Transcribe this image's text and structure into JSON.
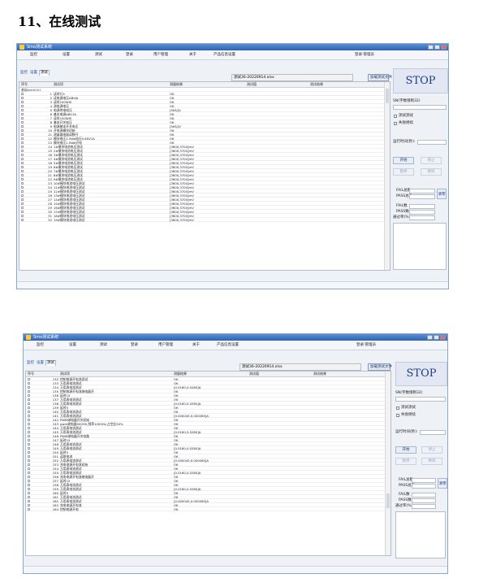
{
  "heading": "11、在线测试",
  "windows": [
    {
      "title": "Smo测试系统",
      "menu": [
        "监控",
        "设置",
        "测试",
        "登录",
        "用户管理",
        "关于",
        "产品信息设置"
      ],
      "menu_right": "登录:管理员",
      "tabs": [
        "监控",
        "设置",
        "测试"
      ],
      "file_name": "测试36-20220914.xlsx",
      "file_button": "加载测试文件",
      "columns": [
        "序号",
        "测试项",
        "测量结果",
        "测试值",
        "测试结果"
      ],
      "group_label": "基础test0001",
      "rows": [
        {
          "n": "1",
          "name": "读时行5",
          "result": "OK"
        },
        {
          "n": "2",
          "name": "读电源电压ABVIA",
          "result": "OK"
        },
        {
          "n": "3",
          "name": "读时100WIS",
          "result": "OK"
        },
        {
          "n": "4",
          "name": "测电源电压",
          "result": "OK"
        },
        {
          "n": "5",
          "name": "电源供电电压",
          "result": "[5kS/]V"
        },
        {
          "n": "6",
          "name": "基本电源ABV1A",
          "result": "OK"
        },
        {
          "n": "7",
          "name": "读时100WIS",
          "result": "OK"
        },
        {
          "n": "8",
          "name": "基本开关电压",
          "result": "OK"
        },
        {
          "n": "9",
          "name": "电源基本开关电压",
          "result": "[5kS/]V"
        },
        {
          "n": "10",
          "name": "开电源模块初始",
          "result": "OK"
        },
        {
          "n": "11",
          "name": "测量器电量读数开",
          "result": "OK"
        },
        {
          "n": "12",
          "name": "模块电压1.5Wa电压5.6SV1A",
          "result": "OK"
        },
        {
          "n": "13",
          "name": "模块电压1.5WA开电",
          "result": "OK"
        },
        {
          "n": "14",
          "name": "1#模块电池电压测试",
          "result": "[3600,3700]mV"
        },
        {
          "n": "15",
          "name": "2#模块电池电压测试",
          "result": "[3600,3700]mV"
        },
        {
          "n": "16",
          "name": "3#模块电池电压测试",
          "result": "[3600,3700]mV"
        },
        {
          "n": "17",
          "name": "4#模块电池电压测试",
          "result": "[3600,3700]mV"
        },
        {
          "n": "18",
          "name": "5#模块电池电压测试",
          "result": "[3600,3700]mV"
        },
        {
          "n": "19",
          "name": "6#模块电池电压测试",
          "result": "[3600,3700]mV"
        },
        {
          "n": "20",
          "name": "7#模块电池电压测试",
          "result": "[3600,3700]mV"
        },
        {
          "n": "21",
          "name": "8#模块电池电压测试",
          "result": "[3600,3700]mV"
        },
        {
          "n": "22",
          "name": "9#模块电池电压测试",
          "result": "[3600,3700]mV"
        },
        {
          "n": "23",
          "name": "10#模块电池电压测试",
          "result": "[3600,3700]mV"
        },
        {
          "n": "24",
          "name": "11#模块电池电压测试",
          "result": "[3600,3700]mV"
        },
        {
          "n": "25",
          "name": "12#模块电池电压测试",
          "result": "[3600,3700]mV"
        },
        {
          "n": "26",
          "name": "13#模块电池电压测试",
          "result": "[3600,3700]mV"
        },
        {
          "n": "27",
          "name": "14#模块电池电压测试",
          "result": "[3600,3700]mV"
        },
        {
          "n": "28",
          "name": "15#模块电池电压测试",
          "result": "[3600,3700]mV"
        },
        {
          "n": "29",
          "name": "16#模块电池电压测试",
          "result": "[3600,3700]mV"
        },
        {
          "n": "30",
          "name": "17#模块电池电压测试",
          "result": "[3600,3700]mV"
        },
        {
          "n": "31",
          "name": "18#模块电池电压测试",
          "result": "[3600,3700]mV"
        },
        {
          "n": "32",
          "name": "19#模块电池电压测试",
          "result": "[3600,3700]mV"
        }
      ],
      "side": {
        "stop": "STOP",
        "sn_label": "SN(字数限制32)",
        "check1": "测试测试",
        "check2": "失败继续",
        "runtime_label": "运行时间(秒):",
        "start": "开始",
        "stop_btn": "停止",
        "pause": "暂停",
        "resume": "继续",
        "pass_total": "PASS总数",
        "fail_total": "FAIL总数",
        "pass_count": "PASS数",
        "fail_count": "FAIL数",
        "clear": "清零",
        "rate": "通过率(%)"
      }
    },
    {
      "title": "Smo测试系统",
      "menu": [
        "监控",
        "设置",
        "测试",
        "登录",
        "用户管理",
        "关于",
        "产品信息设置"
      ],
      "menu_right": "登录:管理员",
      "tabs": [
        "监控",
        "设置",
        "测试"
      ],
      "file_name": "测试36-20220914.xlsx",
      "file_button": "加载测试文件",
      "columns": [
        "序号",
        "测试项",
        "测量结果",
        "测试值",
        "测试结果"
      ],
      "rows": [
        {
          "n": "132",
          "name": "控制电源开电流测试",
          "result": "OK"
        },
        {
          "n": "133",
          "name": "万用表电流测试",
          "result": "OK"
        },
        {
          "n": "134",
          "name": "万用表电流测试",
          "result": "[0.0160,0.0280]A"
        },
        {
          "n": "135",
          "name": "控制电源开电流继电器开",
          "result": "OK"
        },
        {
          "n": "136",
          "name": "延时15",
          "result": "OK"
        },
        {
          "n": "137",
          "name": "万用表电流测试",
          "result": "OK"
        },
        {
          "n": "138",
          "name": "万用表电流测试",
          "result": "[0.0160,0.0280]A"
        },
        {
          "n": "139",
          "name": "延时5",
          "result": "OK"
        },
        {
          "n": "140",
          "name": "万用表电流测试",
          "result": "OK"
        },
        {
          "n": "141",
          "name": "万用表电流测试",
          "result": "[0.000045,0.000065]A"
        },
        {
          "n": "142",
          "name": "PWM继电器开关初始",
          "result": "OK"
        },
        {
          "n": "143",
          "name": "pwm继电器500HV,频率1000Hz,占空比50%",
          "result": "OK"
        },
        {
          "n": "144",
          "name": "万用表电流测试",
          "result": "OK"
        },
        {
          "n": "145",
          "name": "万用表电流测试",
          "result": "[0.0160,0.0280]A"
        },
        {
          "n": "146",
          "name": "PWM继电器开关电路",
          "result": "OK"
        },
        {
          "n": "147",
          "name": "延时15",
          "result": "OK"
        },
        {
          "n": "148",
          "name": "万用表电流测试",
          "result": "OK"
        },
        {
          "n": "149",
          "name": "万用表电流测试",
          "result": "[0.0160,0.0280]A"
        },
        {
          "n": "150",
          "name": "延时5",
          "result": "OK"
        },
        {
          "n": "151",
          "name": "读取电流",
          "result": "OK"
        },
        {
          "n": "152",
          "name": "万用表电流测试",
          "result": "[0.000045,0.000065]A"
        },
        {
          "n": "153",
          "name": "充电电源开电流初始",
          "result": "OK"
        },
        {
          "n": "154",
          "name": "万用表电流测试",
          "result": "OK"
        },
        {
          "n": "155",
          "name": "万用表电流测试",
          "result": "[0.0160,0.0280]A"
        },
        {
          "n": "156",
          "name": "充电电源开电流继电器开",
          "result": "OK"
        },
        {
          "n": "157",
          "name": "延时15",
          "result": "OK"
        },
        {
          "n": "158",
          "name": "万用表电流测试",
          "result": "OK"
        },
        {
          "n": "159",
          "name": "万用表电流测试",
          "result": "[0.0160,0.0280]A"
        },
        {
          "n": "160",
          "name": "延时5",
          "result": "OK"
        },
        {
          "n": "161",
          "name": "万用表电流测试",
          "result": "OK"
        },
        {
          "n": "162",
          "name": "万用表电流测试",
          "result": "[0.000045,0.000065]A"
        },
        {
          "n": "163",
          "name": "充电电源开电流",
          "result": "OK"
        },
        {
          "n": "164",
          "name": "控制电源开电",
          "result": "OK"
        }
      ],
      "side": {
        "stop": "STOP",
        "sn_label": "SN(字数限制32)",
        "check1": "测试测试",
        "check2": "失败继续",
        "runtime_label": "运行时间(秒):",
        "start": "开始",
        "stop_btn": "停止",
        "pause": "暂停",
        "resume": "继续",
        "pass_total": "PASS总数",
        "fail_total": "FAIL总数",
        "pass_count": "PASS数",
        "fail_count": "FAIL数",
        "clear": "清零",
        "rate": "通过率(%)"
      }
    }
  ]
}
